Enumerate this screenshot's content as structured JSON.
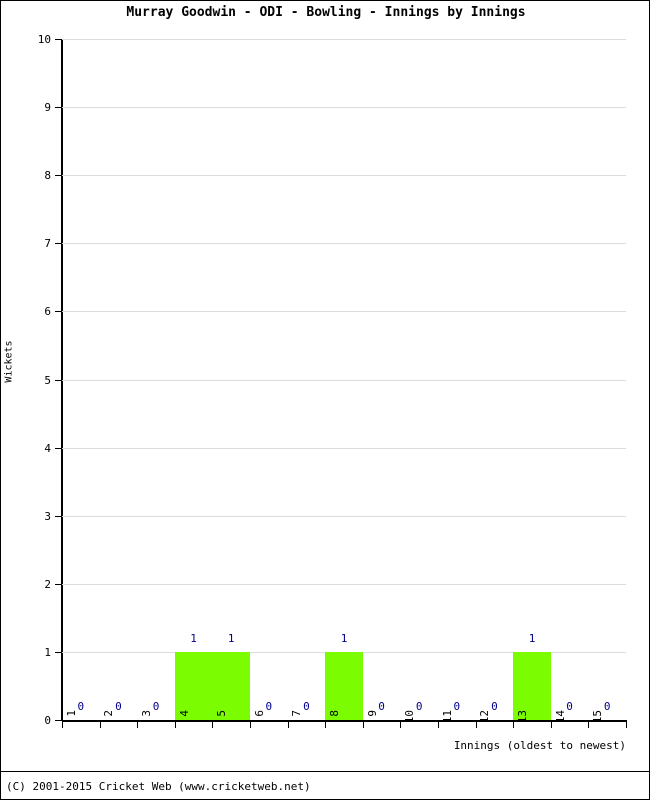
{
  "chart_data": {
    "type": "bar",
    "title": "Murray Goodwin - ODI - Bowling - Innings by Innings",
    "xlabel": "Innings (oldest to newest)",
    "ylabel": "Wickets",
    "categories": [
      "1",
      "2",
      "3",
      "4",
      "5",
      "6",
      "7",
      "8",
      "9",
      "10",
      "11",
      "12",
      "13",
      "14",
      "15"
    ],
    "values": [
      0,
      0,
      0,
      1,
      1,
      0,
      0,
      1,
      0,
      0,
      0,
      0,
      1,
      0,
      0
    ],
    "value_labels": [
      "0",
      "0",
      "0",
      "1",
      "1",
      "0",
      "0",
      "1",
      "0",
      "0",
      "0",
      "0",
      "1",
      "0",
      "0"
    ],
    "ylim": [
      0,
      10
    ],
    "y_ticks": [
      "0",
      "1",
      "2",
      "3",
      "4",
      "5",
      "6",
      "7",
      "8",
      "9",
      "10"
    ],
    "grid": true,
    "legend": false,
    "bar_color": "#7cfc00",
    "value_label_color": "#00008b",
    "gridline_color": "#dcdcdc",
    "axis_color": "#000000"
  },
  "footer": {
    "copyright": "(C) 2001-2015 Cricket Web (www.cricketweb.net)"
  }
}
